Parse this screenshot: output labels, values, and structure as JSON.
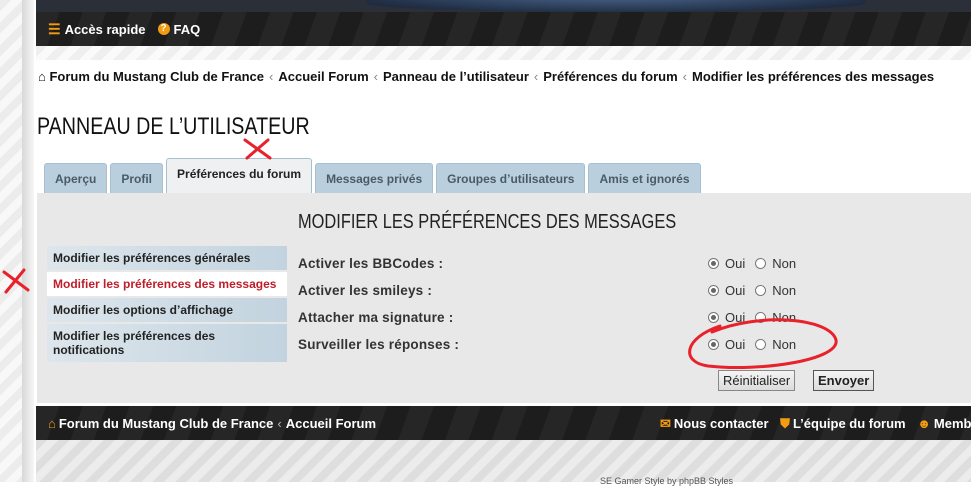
{
  "nav": {
    "quick_access": "Accès rapide",
    "faq": "FAQ"
  },
  "breadcrumb": [
    "Forum du Mustang Club de France",
    "Accueil Forum",
    "Panneau de l’utilisateur",
    "Préférences du forum",
    "Modifier les préférences des messages"
  ],
  "page_title": "PANNEAU DE L’UTILISATEUR",
  "tabs": [
    "Aperçu",
    "Profil",
    "Préférences du forum",
    "Messages privés",
    "Groupes d’utilisateurs",
    "Amis et ignorés"
  ],
  "active_tab": "Préférences du forum",
  "side_menu": [
    "Modifier les préférences générales",
    "Modifier les préférences des messages",
    "Modifier les options d’affichage",
    "Modifier les préférences des notifications"
  ],
  "active_side": "Modifier les préférences des messages",
  "section_title": "MODIFIER LES PRÉFÉRENCES DES MESSAGES",
  "settings": [
    {
      "label": "Activer les BBCodes :",
      "value": "Oui"
    },
    {
      "label": "Activer les smileys :",
      "value": "Oui"
    },
    {
      "label": "Attacher ma signature :",
      "value": "Oui"
    },
    {
      "label": "Surveiller les réponses :",
      "value": "Oui"
    }
  ],
  "option_yes": "Oui",
  "option_no": "Non",
  "buttons": {
    "reset": "Réinitialiser",
    "submit": "Envoyer"
  },
  "footer": {
    "home": "Forum du Mustang Club de France",
    "index": "Accueil Forum",
    "contact": "Nous contacter",
    "team": "L’équipe du forum",
    "members": "Membres"
  },
  "credit": "SE Gamer Style by phpBB Styles",
  "colors": {
    "accent": "#f39c12",
    "tab": "#b9cfdd",
    "active_menu_text": "#bf1d2a",
    "annotation": "#e8212b"
  }
}
